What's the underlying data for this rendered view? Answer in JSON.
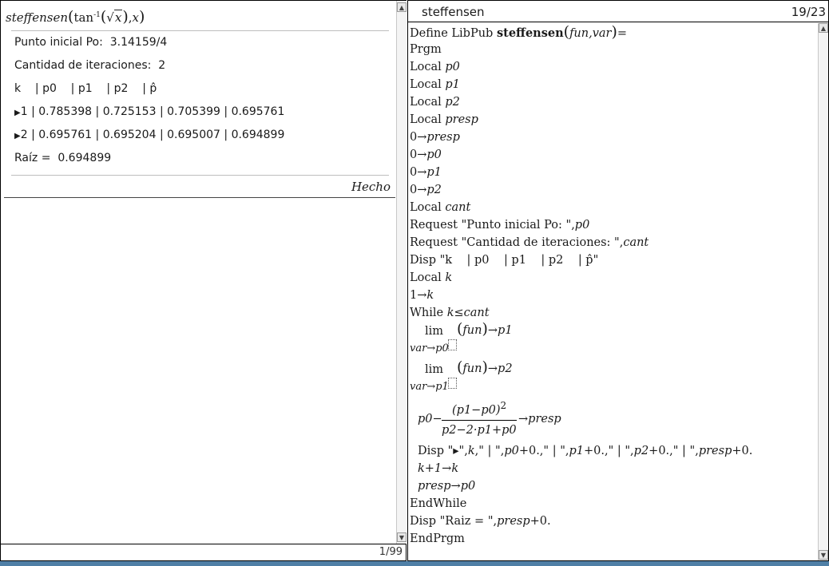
{
  "calculator": {
    "entry": {
      "func": "steffensen",
      "arg_fn": "tan",
      "arg_sup": "-1",
      "arg_inner": "x",
      "arg_var": "x"
    },
    "output": {
      "prompt1_label": "Punto inicial Po:",
      "prompt1_value": "3.14159/4",
      "prompt2_label": "Cantidad de iteraciones:",
      "prompt2_value": "2",
      "header": "k    | p0    | p1    | p2    | p̂",
      "rows": [
        {
          "k": "1",
          "p0": "0.785398",
          "p1": "0.725153",
          "p2": "0.705399",
          "p": "0.695761"
        },
        {
          "k": "2",
          "p0": "0.695761",
          "p1": "0.695204",
          "p2": "0.695007",
          "p": "0.694899"
        }
      ],
      "sep": "|",
      "root_label": "Raíz =",
      "root_value": "0.694899",
      "done": "Hecho"
    },
    "page_count": "1/99"
  },
  "editor": {
    "program_name": "steffensen",
    "line_count": "19/23",
    "define": "Define LibPub",
    "define_name": "steffensen",
    "define_args": "fun,var",
    "define_eq": "=",
    "prgm": "Prgm",
    "local_kw": "Local",
    "locals": [
      "p0",
      "p1",
      "p2",
      "presp"
    ],
    "zero": "0",
    "assign_arrow": "→",
    "assign_targets": [
      "presp",
      "p0",
      "p1",
      "p2"
    ],
    "local_cant": "cant",
    "request_kw": "Request",
    "request1_str": "\"Punto inicial Po: \"",
    "request1_var": "p0",
    "request2_str": "\"Cantidad de iteraciones: \"",
    "request2_var": "cant",
    "disp_kw": "Disp",
    "disp_header_str": "\"k    | p0    | p1    | p2    | p̂\"",
    "local_k": "k",
    "one": "1",
    "k_var": "k",
    "while_kw": "While",
    "while_cond": "k≤cant",
    "lim_word": "lim",
    "fun_name": "fun",
    "lim1_target": "p1",
    "lim1_sub": "var→p0",
    "lim2_target": "p2",
    "lim2_sub": "var→p1",
    "frac_lead": "p0−",
    "frac_num": "(p1−p0)",
    "frac_num_exp": "2",
    "frac_den": "p2−2·p1+p0",
    "frac_target": "presp",
    "disp_loop_a": "\"▸\",",
    "disp_loop_k": "k",
    "disp_loop_b": ",\" | \",",
    "disp_loop_p0": "p0",
    "disp_loop_c": "+0.,\" | \",",
    "disp_loop_p1": "p1",
    "disp_loop_d": "+0.,\" | \",",
    "disp_loop_p2": "p2",
    "disp_loop_e": "+0.,\" | \",",
    "disp_loop_presp": "presp",
    "disp_loop_f": "+0.",
    "k_inc": "k+1",
    "presp_var": "presp",
    "p0_var": "p0",
    "endwhile": "EndWhile",
    "disp_root_str": "\"Raiz = \",",
    "disp_root_var": "presp",
    "disp_root_tail": "+0.",
    "endprgm": "EndPrgm"
  }
}
